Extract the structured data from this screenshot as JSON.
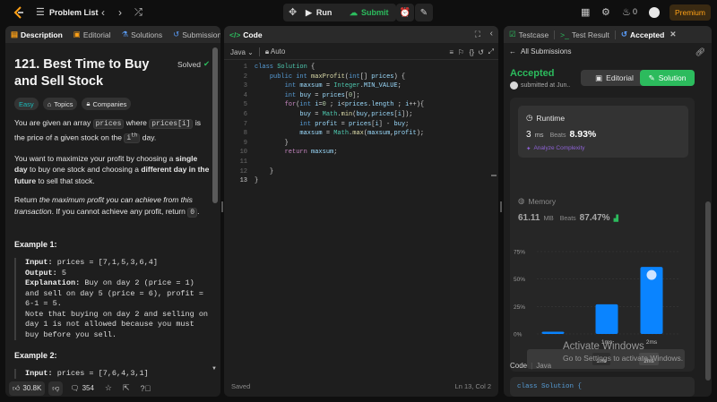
{
  "topbar": {
    "problem_list": "Problem List",
    "run": "Run",
    "submit": "Submit",
    "streak": "0",
    "premium": "Premium"
  },
  "left": {
    "tabs": [
      "Description",
      "Editorial",
      "Solutions",
      "Submissions"
    ],
    "title": "121. Best Time to Buy and Sell Stock",
    "solved": "Solved",
    "chips": [
      "Easy",
      "Topics",
      "Companies"
    ],
    "desc": {
      "p1a": "You are given an array ",
      "p1c1": "prices",
      "p1b": " where ",
      "p1c2": "prices[i]",
      "p1d": " is the price of a given stock on the ",
      "p1e": "i",
      "p1sup": "th",
      "p1f": " day.",
      "p2a": "You want to maximize your profit by choosing a ",
      "p2b": "single day",
      "p2c": " to buy one stock and choosing a ",
      "p2d": "different day in the future",
      "p2e": " to sell that stock.",
      "p3a": "Return ",
      "p3b": "the maximum profit you can achieve from this transaction",
      "p3c": ". If you cannot achieve any profit, return ",
      "p3code": "0",
      "p3d": "."
    },
    "example1": {
      "title": "Example 1:",
      "input_label": "Input:",
      "input": " prices = [7,1,5,3,6,4]",
      "output_label": "Output:",
      "output": " 5",
      "expl_label": "Explanation:",
      "expl": " Buy on day 2 (price = 1) and sell on day 5 (price = 6), profit = 6-1 = 5.",
      "note": "Note that buying on day 2 and selling on day 1 is not allowed because you must buy before you sell."
    },
    "example2": {
      "title": "Example 2:",
      "input_label": "Input:",
      "input": " prices = [7,6,4,3,1]"
    },
    "footer": {
      "likes": "30.8K",
      "comments": "354"
    }
  },
  "mid": {
    "title": "Code",
    "lang": "Java",
    "auto": "Auto",
    "lines": [
      "1",
      "2",
      "3",
      "4",
      "5",
      "6",
      "7",
      "8",
      "9",
      "10",
      "11",
      "12",
      "13"
    ],
    "saved": "Saved",
    "cursor": "Ln 13, Col 2"
  },
  "right": {
    "tabs": [
      "Testcase",
      "Test Result",
      "Accepted"
    ],
    "all_submissions": "All Submissions",
    "status": "Accepted",
    "submitted": "submitted at Jun..",
    "editorial": "Editorial",
    "solution": "Solution",
    "runtime_label": "Runtime",
    "runtime_value": "3",
    "runtime_unit": "ms",
    "runtime_beats": "Beats",
    "runtime_pct": "8.93%",
    "analyze": "Analyze Complexity",
    "memory_label": "Memory",
    "memory_value": "61.11",
    "memory_unit": "MB",
    "memory_beats": "Beats",
    "memory_pct": "87.47%",
    "lower_lang_a": "Code",
    "lower_lang_b": "Java",
    "lower_code": "class Solution {"
  },
  "watermark": {
    "line1": "Activate Windows",
    "line2": "Go to Settings to activate Windows."
  },
  "colors": {
    "accent_green": "#2cbb5d",
    "premium": "#ffa116",
    "bar_blue": "#0a84ff"
  },
  "chart_data": {
    "type": "bar",
    "categories": [
      "",
      "1ms",
      "2ms"
    ],
    "values": [
      2,
      27,
      61
    ],
    "ylim": [
      0,
      75
    ],
    "yticks": [
      "0%",
      "25%",
      "50%",
      "75%"
    ],
    "xticks": [
      "1ms",
      "2ms"
    ],
    "slider_labels": [
      "1ms",
      "2ms"
    ]
  }
}
